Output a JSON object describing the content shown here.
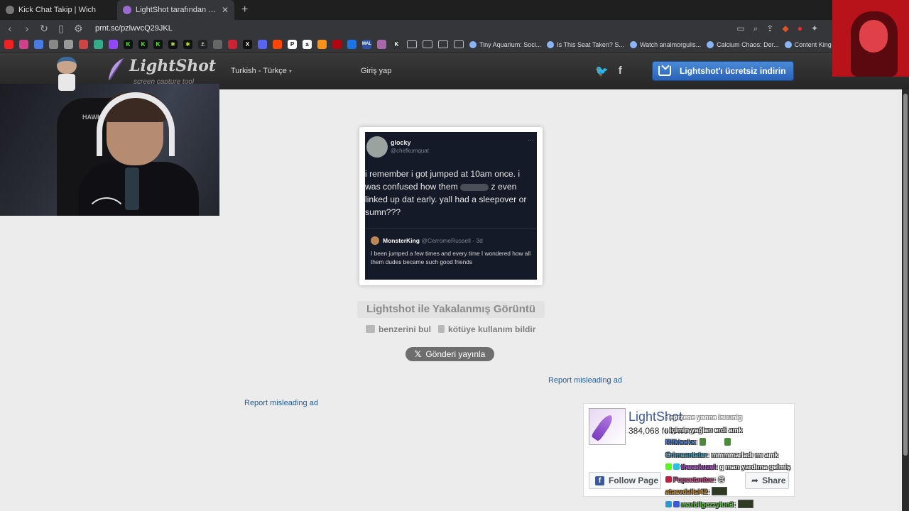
{
  "browser": {
    "tabs": [
      {
        "title": "Kick Chat Takip | Wich",
        "active": false
      },
      {
        "title": "LightShot tarafından Ekran Görü",
        "active": true
      }
    ],
    "url": "prnt.sc/pzlwvcQ29JKL",
    "bookmarks": [
      "Tiny Aquarium: Soci...",
      "Is This Seat Taken? S...",
      "Watch analmorgulis...",
      "Calcium Chaos: Der...",
      "Content King Steam"
    ]
  },
  "header": {
    "logo_text": "LightShot",
    "logo_sub": "screen capture tool",
    "language": "Turkish - Türkçe",
    "login": "Giriş yap",
    "social": {
      "twitter_icon": "twitter-icon",
      "facebook_icon": "facebook-icon"
    },
    "download_label": "Lightshot'ı ücretsiz indirin"
  },
  "screenshot": {
    "tweet": {
      "name": "glocky",
      "handle": "@chefkumquat",
      "text_before": "i remember i got jumped at 10am once. i was confused how them",
      "text_after": "z even linked up dat early. yall had a sleepover or sumn???",
      "quote_name": "MonsterKing",
      "quote_handle": "@CerromeRussell · 3d",
      "quote_text": "I been jumped a few times and every time I wondered how all them dudes became such good friends"
    }
  },
  "caption": {
    "title": "Lightshot ile Yakalanmış Görüntü",
    "find_similar": "benzerini bul",
    "report_abuse": "kötüye kullanım bildir",
    "post_button": "Gönderi yayınla"
  },
  "ads": {
    "report_right": "Report misleading ad",
    "report_left": "Report misleading ad"
  },
  "facebook": {
    "page_name": "LightShot",
    "followers": "384,068 followers",
    "follow_label": "Follow Page",
    "share_label": "Share"
  },
  "chat": [
    {
      "user": "",
      "message": ": eprzene yanna isuunig",
      "color": "#9a7fd0"
    },
    {
      "user": "",
      "message": ": içimin yağları erdi amk",
      "color": "#40c070"
    },
    {
      "user": "Rifkiseks",
      "message": ":",
      "color": "#4a7cd0"
    },
    {
      "user": "Crimeantater",
      "message": ": mmmmarladı mı amk",
      "color": "#4aa0c0"
    },
    {
      "user": "theeskuzel",
      "message": ": g man yardıma gelmiş",
      "color": "#b04ad0"
    },
    {
      "user": "Popeetantoe",
      "message": ":",
      "color": "#d04a8a"
    },
    {
      "user": "ataevdalisi42",
      "message": ":",
      "color": "#c08a30"
    },
    {
      "user": "marbilgezzylun3",
      "message": ":",
      "color": "#5ac040"
    }
  ]
}
